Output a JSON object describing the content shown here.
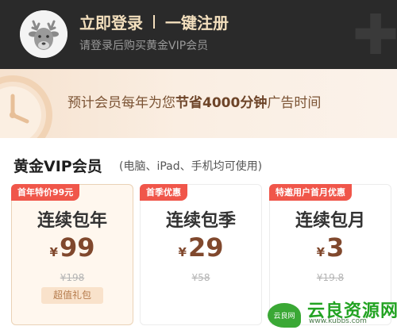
{
  "header": {
    "login_label": "立即登录",
    "register_label": "一键注册",
    "subtitle": "请登录后购买黄金VIP会员"
  },
  "banner": {
    "text_before": "预计会员每年为您",
    "text_highlight": "节省4000分钟",
    "text_after": "广告时间"
  },
  "section": {
    "title": "黄金VIP会员",
    "subtitle": "(电脑、iPad、手机均可使用)"
  },
  "plans": [
    {
      "tag": "首年特价99元",
      "name": "连续包年",
      "currency": "¥",
      "price": "99",
      "original": "¥198",
      "gift": "超值礼包",
      "selected": true
    },
    {
      "tag": "首季优惠",
      "name": "连续包季",
      "currency": "¥",
      "price": "29",
      "original": "¥58",
      "selected": false
    },
    {
      "tag": "特邀用户首月优惠",
      "name": "连续包月",
      "currency": "¥",
      "price": "3",
      "original": "¥19.8",
      "selected": false
    }
  ],
  "watermark": {
    "badge": "云良网",
    "title": "云良资源网",
    "url": "www.kubbs.com"
  },
  "colors": {
    "header_bg": "#2a2a2a",
    "gold_text": "#f3dfbd",
    "tag_red": "#f0564a",
    "price_brown": "#80482d"
  }
}
